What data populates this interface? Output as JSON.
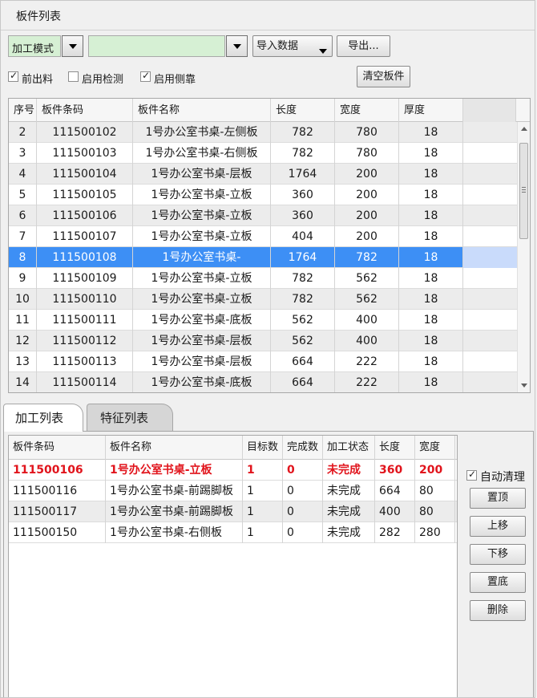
{
  "panel": {
    "title": "板件列表"
  },
  "toolbar": {
    "mode_value": "加工模式",
    "input_value": "",
    "import_label": "导入数据",
    "export_label": "导出..."
  },
  "options": {
    "front_feed": {
      "label": "前出料",
      "checked": true
    },
    "enable_check": {
      "label": "启用检测",
      "checked": false
    },
    "enable_side": {
      "label": "启用侧靠",
      "checked": true
    },
    "clear_label": "清空板件"
  },
  "board_grid": {
    "headers": [
      "序号",
      "板件条码",
      "板件名称",
      "长度",
      "宽度",
      "厚度"
    ],
    "rows": [
      [
        "2",
        "111500102",
        "1号办公室书桌-左侧板",
        "782",
        "780",
        "18"
      ],
      [
        "3",
        "111500103",
        "1号办公室书桌-右侧板",
        "782",
        "780",
        "18"
      ],
      [
        "4",
        "111500104",
        "1号办公室书桌-层板",
        "1764",
        "200",
        "18"
      ],
      [
        "5",
        "111500105",
        "1号办公室书桌-立板",
        "360",
        "200",
        "18"
      ],
      [
        "6",
        "111500106",
        "1号办公室书桌-立板",
        "360",
        "200",
        "18"
      ],
      [
        "7",
        "111500107",
        "1号办公室书桌-立板",
        "404",
        "200",
        "18"
      ],
      [
        "8",
        "111500108",
        "1号办公室书桌-",
        "1764",
        "782",
        "18"
      ],
      [
        "9",
        "111500109",
        "1号办公室书桌-立板",
        "782",
        "562",
        "18"
      ],
      [
        "10",
        "111500110",
        "1号办公室书桌-立板",
        "782",
        "562",
        "18"
      ],
      [
        "11",
        "111500111",
        "1号办公室书桌-底板",
        "562",
        "400",
        "18"
      ],
      [
        "12",
        "111500112",
        "1号办公室书桌-层板",
        "562",
        "400",
        "18"
      ],
      [
        "13",
        "111500113",
        "1号办公室书桌-层板",
        "664",
        "222",
        "18"
      ],
      [
        "14",
        "111500114",
        "1号办公室书桌-底板",
        "664",
        "222",
        "18"
      ]
    ],
    "selected_row": 6
  },
  "tabs": [
    {
      "label": "加工列表",
      "active": true
    },
    {
      "label": "特征列表",
      "active": false
    }
  ],
  "process_grid": {
    "headers": [
      "板件条码",
      "板件名称",
      "目标数",
      "完成数",
      "加工状态",
      "长度",
      "宽度"
    ],
    "rows": [
      [
        "111500106",
        "1号办公室书桌-立板",
        "1",
        "0",
        "未完成",
        "360",
        "200"
      ],
      [
        "111500116",
        "1号办公室书桌-前踢脚板",
        "1",
        "0",
        "未完成",
        "664",
        "80"
      ],
      [
        "111500117",
        "1号办公室书桌-前踢脚板",
        "1",
        "0",
        "未完成",
        "400",
        "80"
      ],
      [
        "111500150",
        "1号办公室书桌-右侧板",
        "1",
        "0",
        "未完成",
        "282",
        "280"
      ]
    ],
    "highlight_color": "#e1141c"
  },
  "side_panel": {
    "auto_clear": {
      "label": "自动清理",
      "checked": true
    },
    "buttons": {
      "top": "置顶",
      "up": "上移",
      "down": "下移",
      "bottom": "置底",
      "delete": "删除"
    }
  },
  "colors": {
    "selection": "#3d8ff5",
    "combo_bg": "#d6f0d4"
  }
}
